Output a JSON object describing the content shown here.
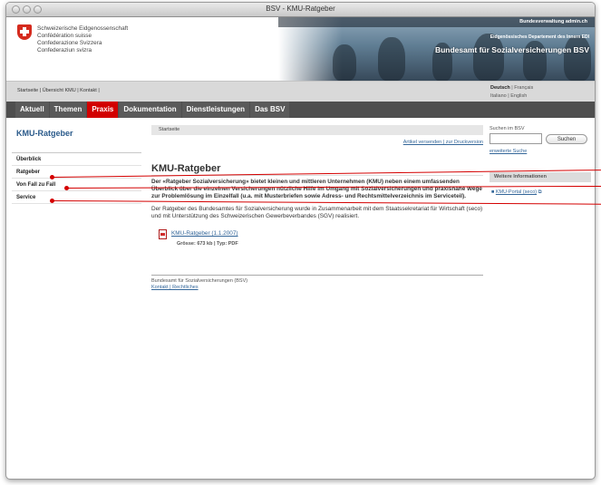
{
  "window": {
    "title": "BSV - KMU-Ratgeber"
  },
  "header": {
    "confederation": [
      "Schweizerische Eidgenossenschaft",
      "Confédération suisse",
      "Confederazione Svizzera",
      "Confederaziun svizra"
    ],
    "top_bar": "Bundesverwaltung admin.ch",
    "department": "Eidgenössisches Departement des Innern EDI",
    "office": "Bundesamt für Sozialversicherungen BSV"
  },
  "service_links": "Startseite | Übersicht KMU | Kontakt |",
  "languages": {
    "current": "Deutsch",
    "line1_other": "| Français",
    "line2": "Italiano | English"
  },
  "nav": [
    "Aktuell",
    "Themen",
    "Praxis",
    "Dokumentation",
    "Dienstleistungen",
    "Das BSV"
  ],
  "sidebar": {
    "title": "KMU-Ratgeber",
    "items": [
      "Überblick",
      "Ratgeber",
      "Von Fall zu Fall",
      "Service"
    ]
  },
  "main": {
    "breadcrumb": "Startseite",
    "tools": "Artikel versenden | zur Druckversion",
    "title": "KMU-Ratgeber",
    "lead": "Der «Ratgeber Sozialversicherung» bietet kleinen und mittleren Unternehmen (KMU) neben einem umfassenden Überblick über die einzelnen Versicherungen nützliche Hilfe im Umgang mit Sozialversicherungen und praxisnahe Wege zur Problemlösung im Einzelfall (u.a. mit Musterbriefen sowie Adress- und Rechtsmittelverzeichnis im Serviceteil).",
    "paragraph": "Der Ratgeber des Bundesamtes für Sozialversicherung wurde in Zusammenarbeit mit dem Staatssekretariat für Wirtschaft (seco) und mit Unterstützung des Schweizerischen Gewerbeverbandes (SGV) realisiert.",
    "document_link": "KMU-Ratgeber (1.1.2007)",
    "document_meta": "Grösse: 673 kb | Typ: PDF",
    "footer_name": "Bundesamt für Sozialversicherungen (BSV)",
    "footer_links": "Kontakt | Rechtliches"
  },
  "right": {
    "search_label": "Suchen im BSV",
    "search_button": "Suchen",
    "advanced": "erweiterte Suche",
    "more_title": "Weitere Informationen",
    "more_link": "KMU-Portal (seco)"
  },
  "colors": {
    "nav_bg": "#4e4e4e",
    "nav_active": "#d20000",
    "link": "#336699",
    "sidebar_title": "#2a5a8a",
    "annotation": "#d40000"
  }
}
